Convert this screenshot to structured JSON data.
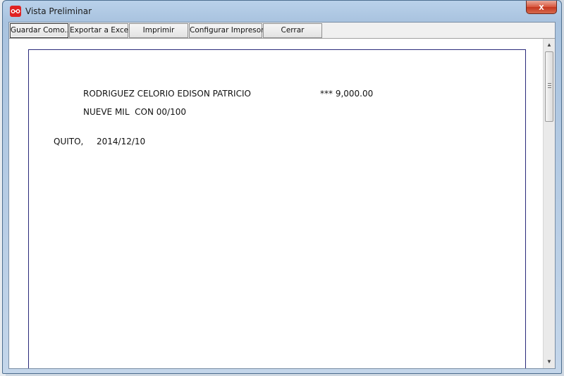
{
  "window": {
    "title": "Vista Preliminar",
    "close_label": "x"
  },
  "toolbar": {
    "buttons": [
      {
        "label": "Guardar Como..."
      },
      {
        "label": "Exportar a Excel"
      },
      {
        "label": "Imprimir"
      },
      {
        "label": "Configurar Impresora"
      },
      {
        "label": "Cerrar"
      }
    ]
  },
  "document": {
    "payee": "RODRIGUEZ CELORIO EDISON PATRICIO",
    "amount": "*** 9,000.00",
    "amount_words": "NUEVE MIL  CON 00/100",
    "city": "QUITO,",
    "date": "2014/12/10"
  },
  "scrollbar": {
    "up_icon": "arrow-up-icon",
    "down_icon": "arrow-down-icon"
  },
  "colors": {
    "close_button": "#d8553c",
    "paper_border": "#2a2a7a"
  }
}
